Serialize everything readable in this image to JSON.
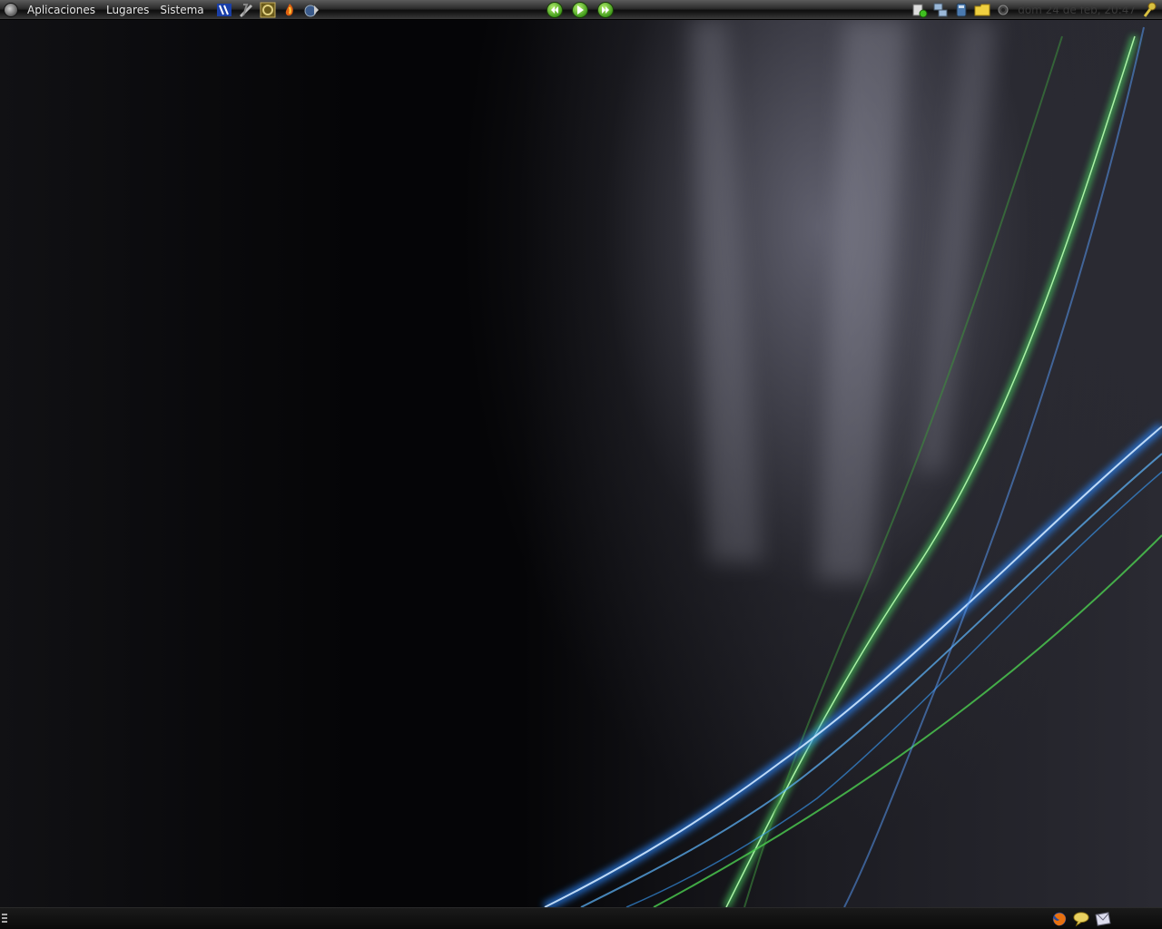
{
  "top_panel": {
    "menus": [
      "Aplicaciones",
      "Lugares",
      "Sistema"
    ],
    "launchers": [
      "app-launcher-icon",
      "editor-launcher-icon",
      "game-launcher-icon",
      "firefox-launcher-icon",
      "network-launcher-icon"
    ],
    "media_controls": [
      "previous-track-icon",
      "play-icon",
      "next-track-icon"
    ],
    "tray_icons": [
      "update-notifier-icon",
      "network-status-icon",
      "drive-icon",
      "folder-icon",
      "volume-icon"
    ],
    "clock": "dom 24 de feb, 20:47"
  },
  "bottom_panel": {
    "tray_icons": [
      "firefox-icon",
      "chat-icon",
      "mail-icon"
    ]
  },
  "colors": {
    "panel": "#2c2c2c",
    "menu_text": "#e6e6e6",
    "clock_text": "#3a3a3a",
    "media_green": "#3f9a1a"
  }
}
